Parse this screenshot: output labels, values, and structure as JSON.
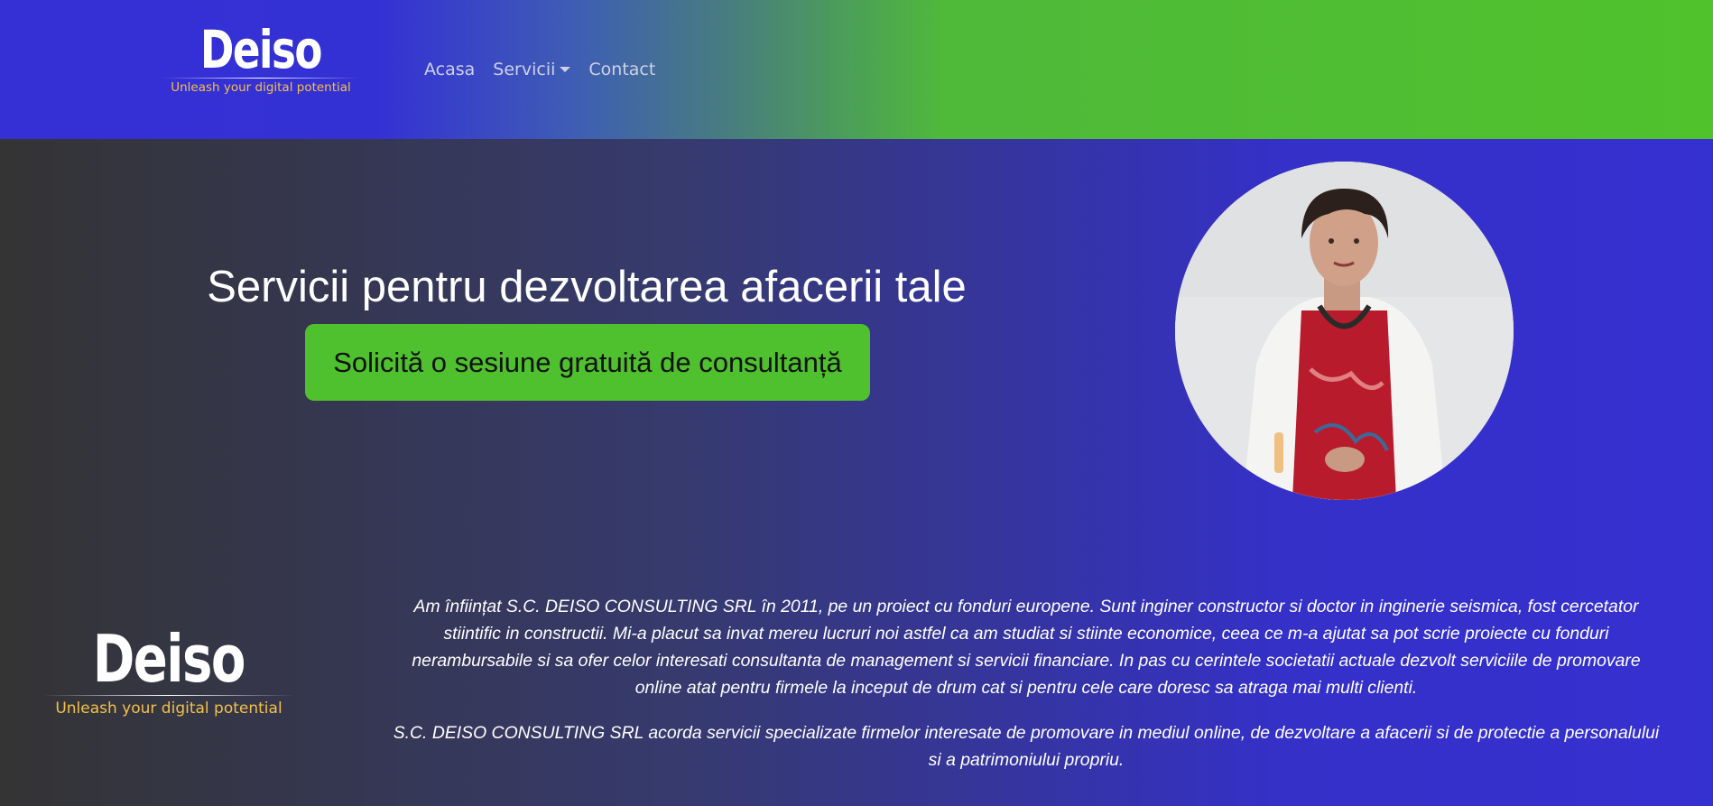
{
  "header": {
    "logo": {
      "word": "Deiso",
      "tagline": "Unleash your digital potential"
    },
    "nav": [
      {
        "label": "Acasa"
      },
      {
        "label": "Servicii",
        "has_dropdown": true
      },
      {
        "label": "Contact"
      }
    ],
    "gradient_colors": [
      "#3530d6",
      "#50c22c"
    ]
  },
  "hero": {
    "title": "Servicii pentru dezvoltarea afacerii tale",
    "cta_label": "Solicită o sesiune gratuită de consultanță",
    "cta_color": "#4fc02e"
  },
  "footer_logo": {
    "word": "Deiso",
    "tagline": "Unleash your digital potential"
  },
  "about": {
    "paragraph_1": "Am înființat S.C. DEISO CONSULTING SRL în 2011, pe un proiect cu fonduri europene. Sunt inginer constructor si doctor in inginerie seismica, fost cercetator stiintific in constructii. Mi-a placut sa invat mereu lucruri noi astfel ca am studiat si stiinte economice, ceea ce m-a ajutat sa pot scrie proiecte cu fonduri nerambursabile si sa ofer celor interesati consultanta de management si servicii financiare. In pas cu cerintele societatii actuale dezvolt serviciile de promovare online atat pentru firmele la inceput de drum cat si pentru cele care doresc sa atraga mai multi clienti.",
    "paragraph_2": "S.C. DEISO CONSULTING SRL acorda servicii specializate firmelor interesate de promovare in mediul online, de dezvoltare a afacerii si de protectie a personalului si a patrimoniului propriu."
  }
}
